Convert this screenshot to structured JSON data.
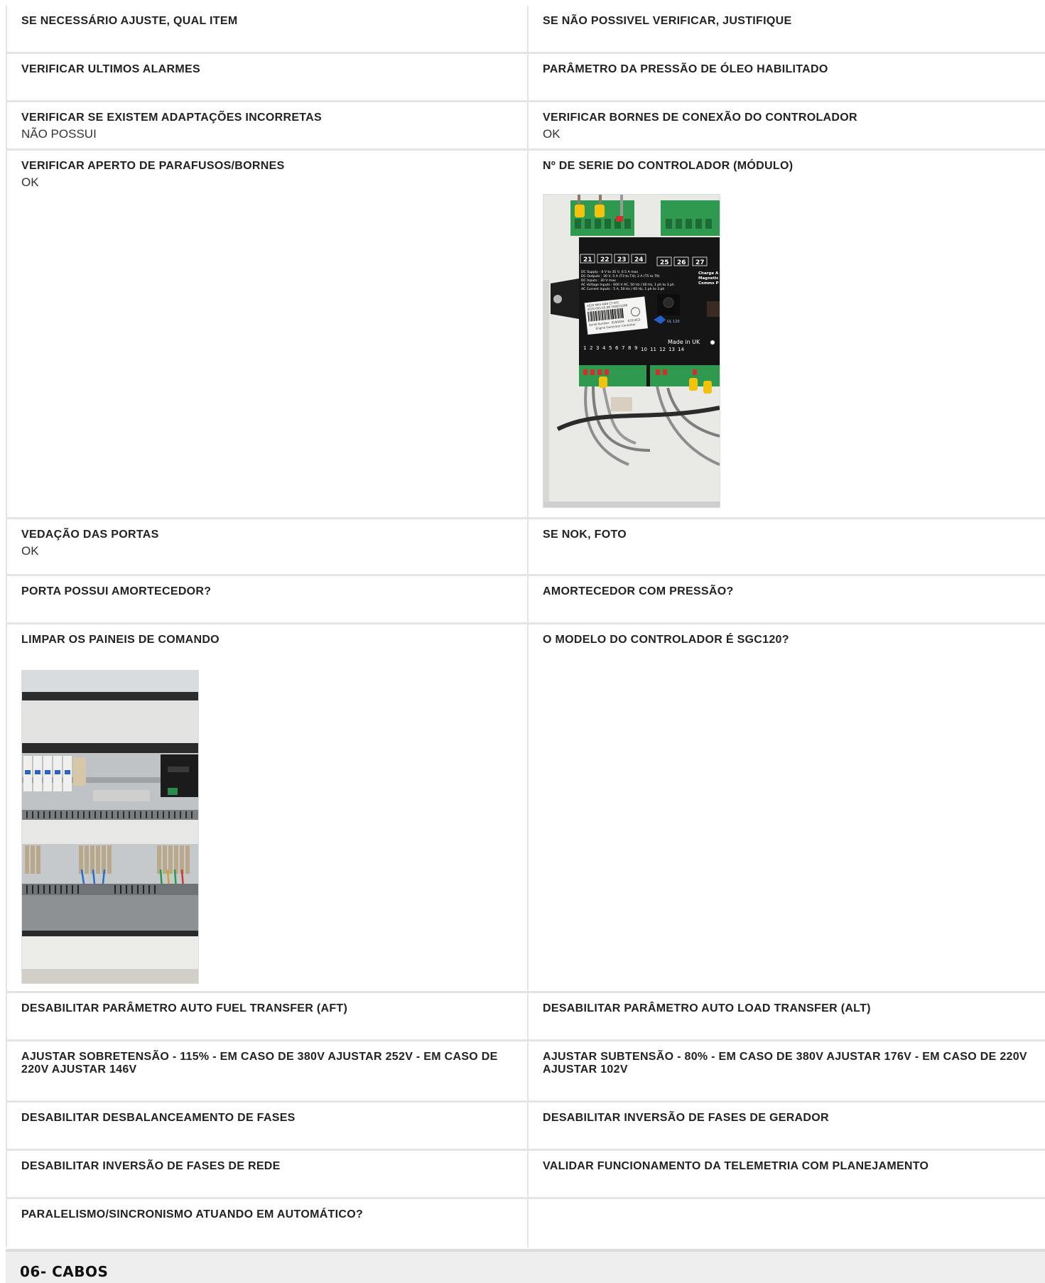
{
  "rows": [
    {
      "left": {
        "label": "SE NECESSÁRIO AJUSTE, QUAL ITEM",
        "value": ""
      },
      "right": {
        "label": "SE NÃO POSSIVEL VERIFICAR, JUSTIFIQUE",
        "value": ""
      }
    },
    {
      "left": {
        "label": "VERIFICAR ULTIMOS ALARMES",
        "value": ""
      },
      "right": {
        "label": "PARÂMETRO DA PRESSÃO DE ÓLEO HABILITADO",
        "value": ""
      }
    },
    {
      "left": {
        "label": "VERIFICAR SE EXISTEM ADAPTAÇÕES INCORRETAS",
        "value": "NÃO POSSUI"
      },
      "right": {
        "label": "VERIFICAR BORNES DE CONEXÃO DO CONTROLADOR",
        "value": "OK"
      }
    },
    {
      "left": {
        "label": "VERIFICAR APERTO DE PARAFUSOS/BORNES",
        "value": "OK"
      },
      "right": {
        "label": "Nº DE SERIE DO CONTROLADOR (MÓDULO)",
        "value": ""
      }
    },
    {
      "left": {
        "label": "VEDAÇÃO DAS PORTAS",
        "value": "OK"
      },
      "right": {
        "label": "SE NOK, FOTO",
        "value": ""
      }
    },
    {
      "left": {
        "label": "PORTA POSSUI AMORTECEDOR?",
        "value": ""
      },
      "right": {
        "label": "AMORTECEDOR COM PRESSÃO?",
        "value": ""
      }
    },
    {
      "left": {
        "label": "LIMPAR OS PAINEIS DE COMANDO",
        "value": ""
      },
      "right": {
        "label": "O MODELO DO CONTROLADOR É SGC120?",
        "value": ""
      }
    },
    {
      "left": {
        "label": "DESABILITAR PARÂMETRO AUTO FUEL TRANSFER (AFT)",
        "value": ""
      },
      "right": {
        "label": "DESABILITAR PARÂMETRO AUTO LOAD TRANSFER (ALT)",
        "value": ""
      }
    },
    {
      "left": {
        "label": "AJUSTAR SOBRETENSÃO - 115% - EM CASO DE 380V AJUSTAR 252V - EM CASO DE 220V AJUSTAR 146V",
        "value": ""
      },
      "right": {
        "label": "AJUSTAR SUBTENSÃO - 80% - EM CASO DE 380V AJUSTAR 176V - EM CASO DE 220V AJUSTAR 102V",
        "value": ""
      }
    },
    {
      "left": {
        "label": "DESABILITAR DESBALANCEAMENTO DE FASES",
        "value": ""
      },
      "right": {
        "label": "DESABILITAR INVERSÃO DE FASES DE GERADOR",
        "value": ""
      }
    },
    {
      "left": {
        "label": "DESABILITAR INVERSÃO DE FASES DE REDE",
        "value": ""
      },
      "right": {
        "label": "VALIDAR FUNCIONAMENTO DA TELEMETRIA COM PLANEJAMENTO",
        "value": ""
      }
    },
    {
      "left": {
        "label": "PARALELISMO/SINCRONISMO ATUANDO EM AUTOMÁTICO?",
        "value": ""
      },
      "right": {
        "label": "",
        "value": ""
      }
    }
  ],
  "controller_photo": {
    "terminals_top": [
      "21",
      "22",
      "23",
      "24",
      "25",
      "26",
      "27"
    ],
    "spec_lines": [
      "DC Supply :      8 V to 35 V,  0.5 A max",
      "DC Outputs :     30 V, 5 A (T3 to T4); 2 A (T5 to T9)",
      "DC Inputs :      30 V max",
      "AC Voltage Inputs : 600 V AC, 50 Hz / 60 Hz, 1 ph to 3 ph",
      "AC Current Inputs : 5 A, 50 Hz / 60 Hz, 1 ph to 3 ph"
    ],
    "side_text": [
      "Charge A",
      "Magnetic",
      "Comms P"
    ],
    "label_line1": "4520 MKII  4W0  CT  RTC",
    "label_line2": "4520-005-05   JMI  F00015288",
    "serial_label": "Serial Number",
    "serial_value": "8190004",
    "serial_code": "E201853",
    "product_line": "Engine Generator Controller",
    "made_in": "Made in UK",
    "terminals_bottom": [
      "1",
      "2",
      "3",
      "4",
      "5",
      "6",
      "7",
      "8",
      "9",
      "10",
      "11",
      "12",
      "13",
      "14"
    ]
  },
  "section": {
    "title": "06- CABOS"
  }
}
